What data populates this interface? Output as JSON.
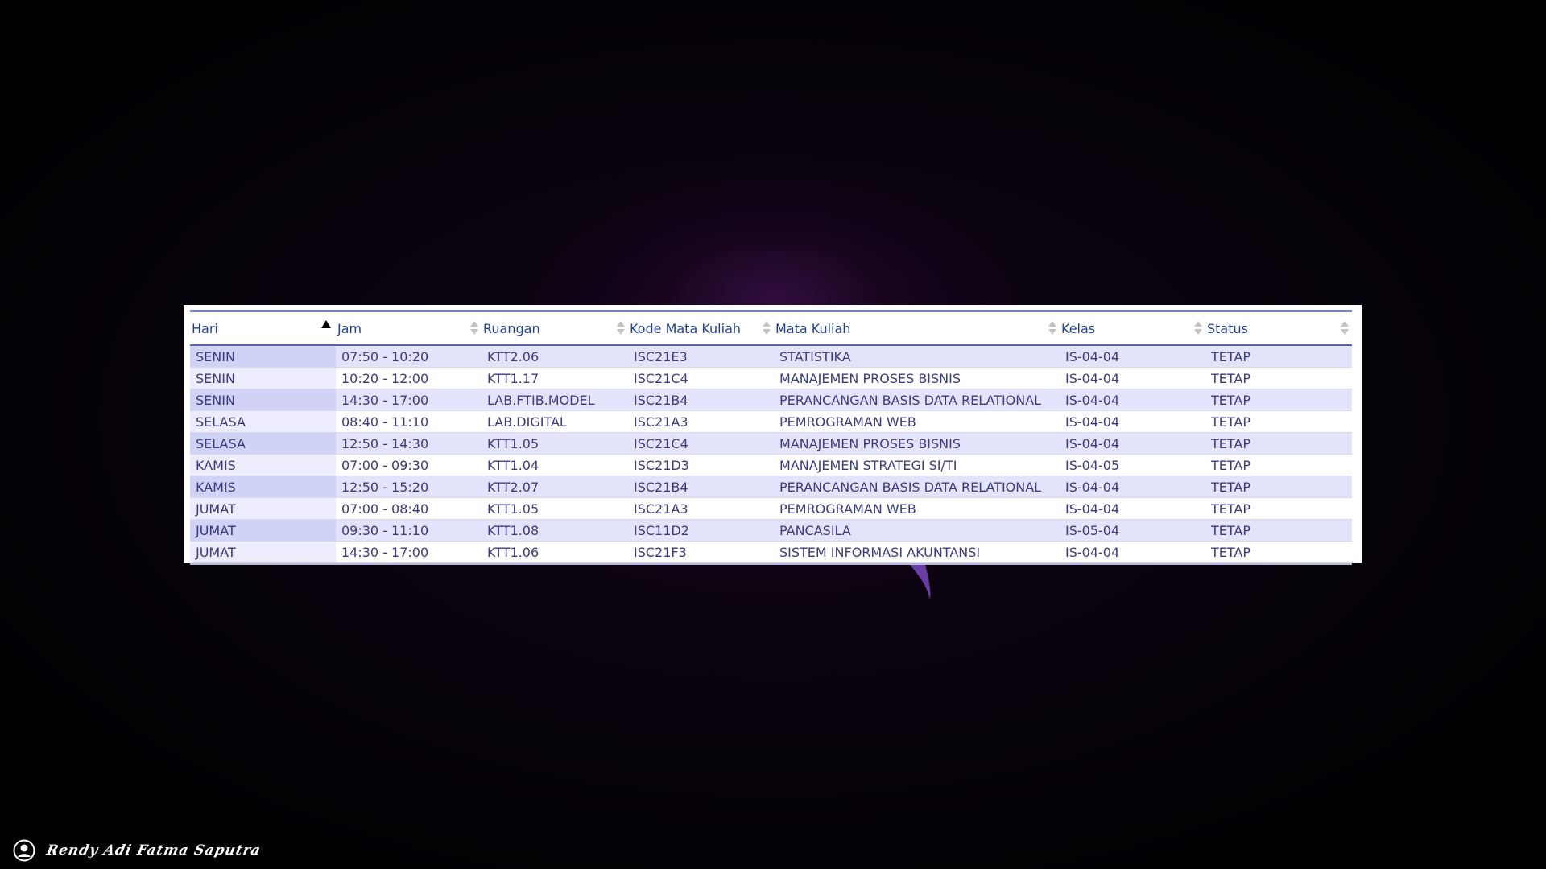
{
  "table": {
    "columns": [
      "Hari",
      "Jam",
      "Ruangan",
      "Kode Mata Kuliah",
      "Mata Kuliah",
      "Kelas",
      "Status"
    ],
    "sorted_column": "Hari",
    "sort_direction": "ascending",
    "rows": [
      [
        "SENIN",
        "07:50 - 10:20",
        "KTT2.06",
        "ISC21E3",
        "STATISTIKA",
        "IS-04-04",
        "TETAP"
      ],
      [
        "SENIN",
        "10:20 - 12:00",
        "KTT1.17",
        "ISC21C4",
        "MANAJEMEN PROSES BISNIS",
        "IS-04-04",
        "TETAP"
      ],
      [
        "SENIN",
        "14:30 - 17:00",
        "LAB.FTIB.MODEL",
        "ISC21B4",
        "PERANCANGAN BASIS DATA RELATIONAL",
        "IS-04-04",
        "TETAP"
      ],
      [
        "SELASA",
        "08:40 - 11:10",
        "LAB.DIGITAL",
        "ISC21A3",
        "PEMROGRAMAN WEB",
        "IS-04-04",
        "TETAP"
      ],
      [
        "SELASA",
        "12:50 - 14:30",
        "KTT1.05",
        "ISC21C4",
        "MANAJEMEN PROSES BISNIS",
        "IS-04-04",
        "TETAP"
      ],
      [
        "KAMIS",
        "07:00 - 09:30",
        "KTT1.04",
        "ISC21D3",
        "MANAJEMEN STRATEGI SI/TI",
        "IS-04-05",
        "TETAP"
      ],
      [
        "KAMIS",
        "12:50 - 15:20",
        "KTT2.07",
        "ISC21B4",
        "PERANCANGAN BASIS DATA RELATIONAL",
        "IS-04-04",
        "TETAP"
      ],
      [
        "JUMAT",
        "07:00 - 08:40",
        "KTT1.05",
        "ISC21A3",
        "PEMROGRAMAN WEB",
        "IS-04-04",
        "TETAP"
      ],
      [
        "JUMAT",
        "09:30 - 11:10",
        "KTT1.08",
        "ISC11D2",
        "PANCASILA",
        "IS-05-04",
        "TETAP"
      ],
      [
        "JUMAT",
        "14:30 - 17:00",
        "KTT1.06",
        "ISC21F3",
        "SISTEM INFORMASI AKUNTANSI",
        "IS-04-04",
        "TETAP"
      ]
    ]
  },
  "footer": {
    "author_name": "Rendy Adi Fatma Saputra",
    "author_icon": "user-icon"
  },
  "colors": {
    "header_text": "#1f3f99",
    "cell_text": "#3a3b82",
    "row_odd": "#e3e4fb",
    "row_even": "#ffffff",
    "accent": "#6b3aa8"
  }
}
